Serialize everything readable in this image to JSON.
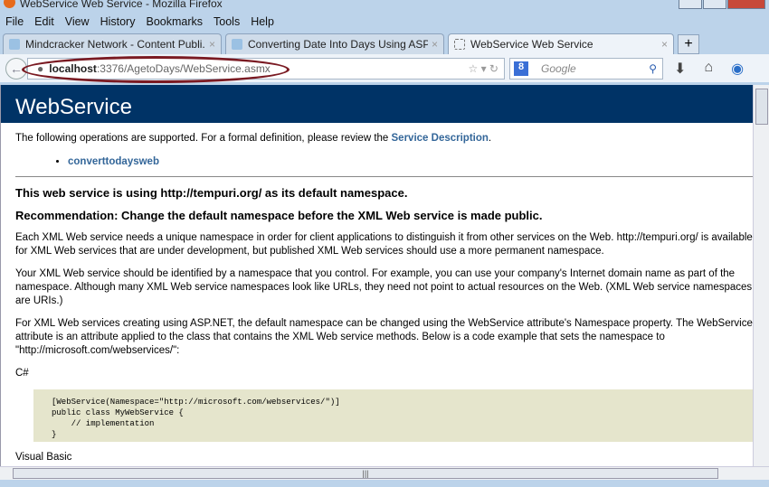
{
  "window": {
    "title": "WebService Web Service - Mozilla Firefox"
  },
  "menu": [
    "File",
    "Edit",
    "View",
    "History",
    "Bookmarks",
    "Tools",
    "Help"
  ],
  "tabs": [
    {
      "label": "Mindcracker Network - Content Publi..."
    },
    {
      "label": "Converting Date Into Days Using ASP...."
    },
    {
      "label": "WebService Web Service"
    }
  ],
  "url": {
    "host": "localhost",
    "path": ":3376/AgetoDays/WebService.asmx"
  },
  "search": {
    "placeholder": "Google"
  },
  "page": {
    "title": "WebService",
    "intro": "The following operations are supported. For a formal definition, please review the ",
    "service_link": "Service Description",
    "operations": [
      "converttodaysweb"
    ],
    "ns_heading": "This web service is using http://tempuri.org/ as its default namespace.",
    "rec_heading": "Recommendation: Change the default namespace before the XML Web service is made public.",
    "p1": "Each XML Web service needs a unique namespace in order for client applications to distinguish it from other services on the Web. http://tempuri.org/ is available for XML Web services that are under development, but published XML Web services should use a more permanent namespace.",
    "p2": "Your XML Web service should be identified by a namespace that you control. For example, you can use your company's Internet domain name as part of the namespace. Although many XML Web service namespaces look like URLs, they need not point to actual resources on the Web. (XML Web service namespaces are URIs.)",
    "p3": "For XML Web services creating using ASP.NET, the default namespace can be changed using the WebService attribute's Namespace property. The WebService attribute is an attribute applied to the class that contains the XML Web service methods. Below is a code example that sets the namespace to \"http://microsoft.com/webservices/\":",
    "cs_label": "C#",
    "code": "[WebService(Namespace=\"http://microsoft.com/webservices/\")]\npublic class MyWebService {\n    // implementation\n}",
    "vb_label": "Visual Basic"
  }
}
